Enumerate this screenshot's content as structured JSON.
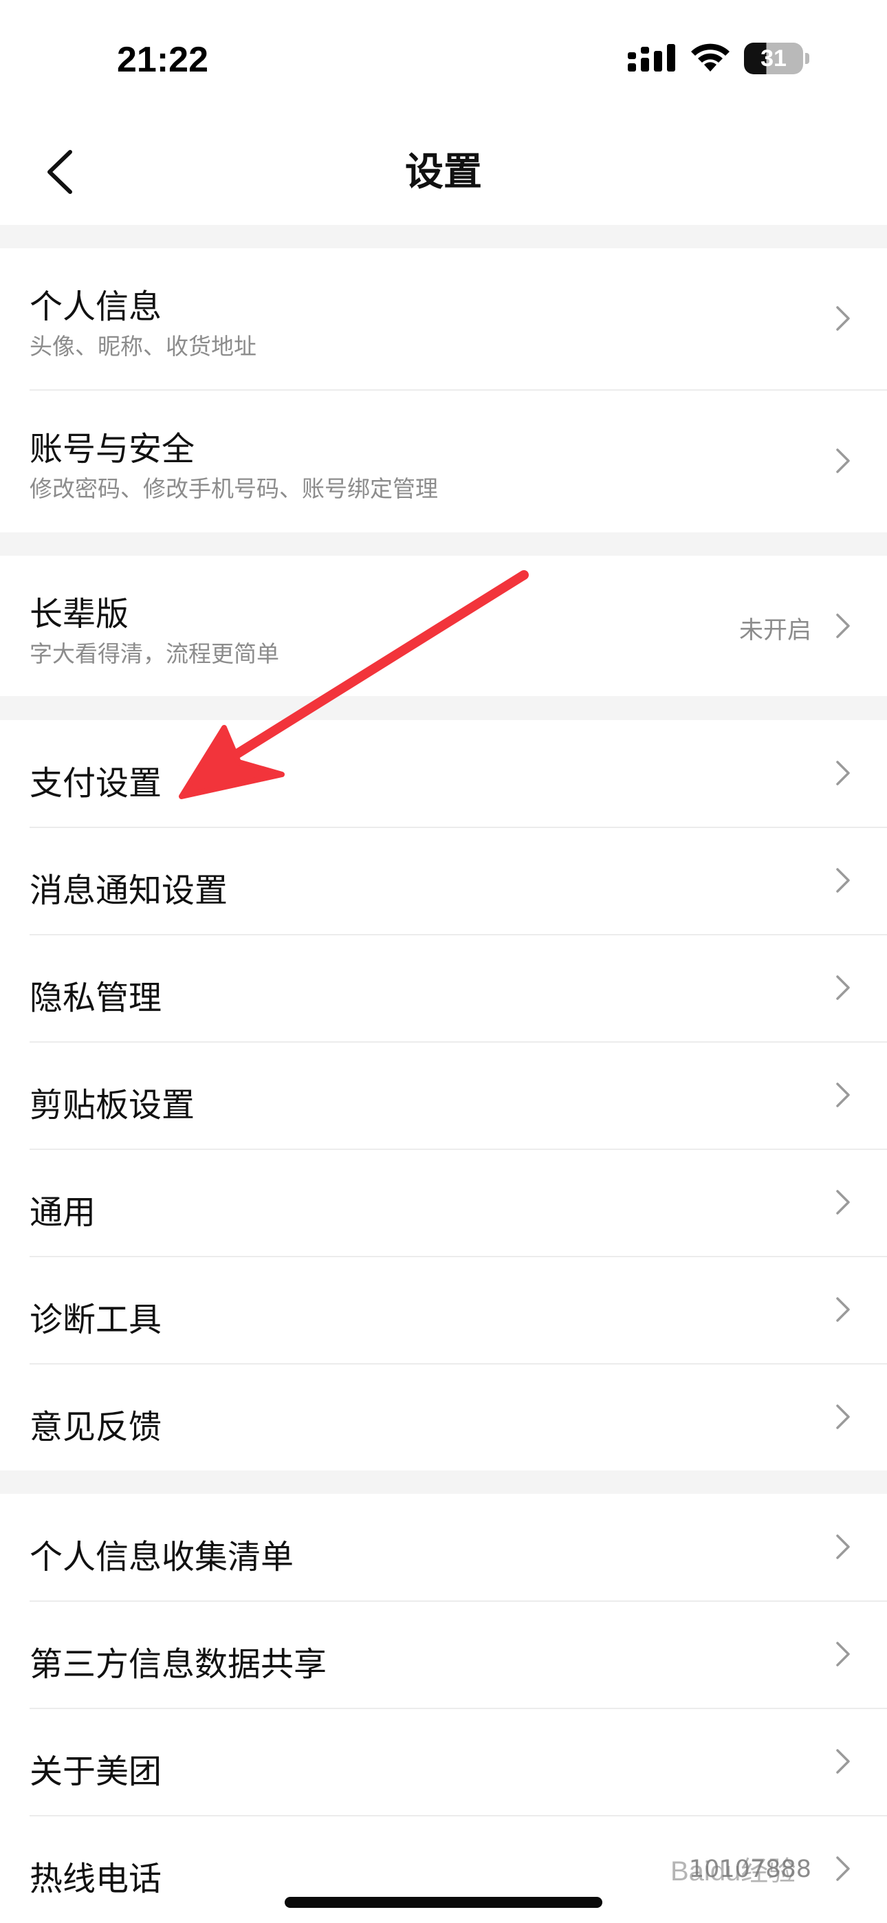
{
  "status_bar": {
    "time": "21:22",
    "battery_level": "31",
    "icons": [
      "signal-icon",
      "wifi-icon",
      "battery-icon"
    ]
  },
  "nav": {
    "title": "设置",
    "back_icon": "chevron-left-icon"
  },
  "groups": [
    {
      "items": [
        {
          "title": "个人信息",
          "subtitle": "头像、昵称、收货地址"
        },
        {
          "title": "账号与安全",
          "subtitle": "修改密码、修改手机号码、账号绑定管理"
        }
      ]
    },
    {
      "items": [
        {
          "title": "长辈版",
          "subtitle": "字大看得清，流程更简单",
          "value": "未开启"
        }
      ]
    },
    {
      "items": [
        {
          "title": "支付设置"
        },
        {
          "title": "消息通知设置"
        },
        {
          "title": "隐私管理"
        },
        {
          "title": "剪贴板设置"
        },
        {
          "title": "通用"
        },
        {
          "title": "诊断工具"
        },
        {
          "title": "意见反馈"
        }
      ]
    },
    {
      "items": [
        {
          "title": "个人信息收集清单"
        },
        {
          "title": "第三方信息数据共享"
        },
        {
          "title": "关于美团"
        },
        {
          "title": "热线电话",
          "value": "10107888"
        }
      ]
    }
  ],
  "watermark": "Baidu经验",
  "colors": {
    "annotation_arrow": "#f2343b",
    "background": "#f4f4f4",
    "secondary_text": "#8c8c8c"
  }
}
